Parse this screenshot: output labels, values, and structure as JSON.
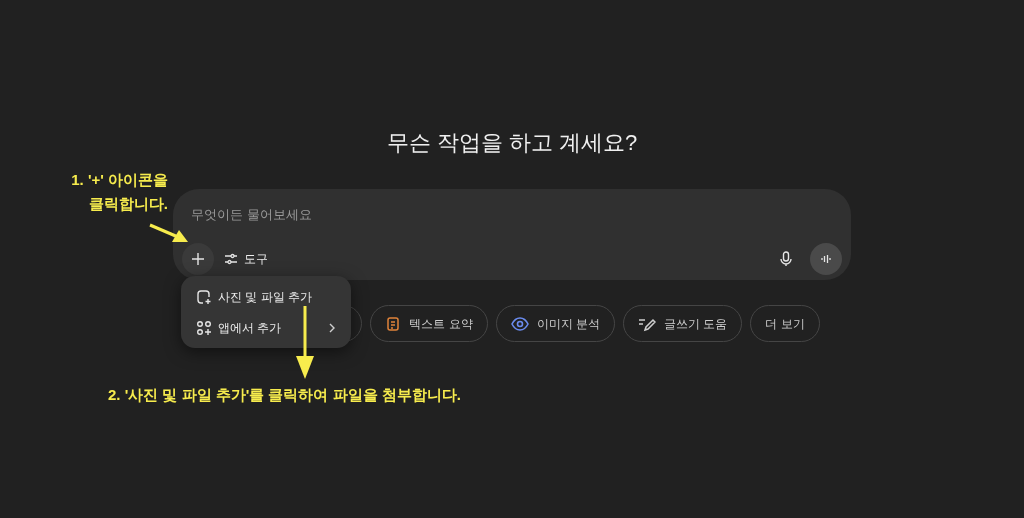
{
  "heading": "무슨 작업을 하고 계세요?",
  "composer": {
    "placeholder": "무엇이든 물어보세요",
    "tools_label": "도구"
  },
  "suggestions": [
    {
      "label": "텍스트 요약",
      "kind": "summary"
    },
    {
      "label": "이미지 분석",
      "kind": "image"
    },
    {
      "label": "글쓰기 도움",
      "kind": "writing"
    },
    {
      "label": "더 보기",
      "kind": "more"
    }
  ],
  "menu": [
    {
      "label": "사진 및 파일 추가",
      "kind": "attach"
    },
    {
      "label": "앱에서 추가",
      "kind": "apps"
    }
  ],
  "annotations": [
    "1. '+' 아이콘을\n클릭합니다.",
    "2. '사진 및 파일 추가'를 클릭하여 파일을 첨부합니다."
  ]
}
